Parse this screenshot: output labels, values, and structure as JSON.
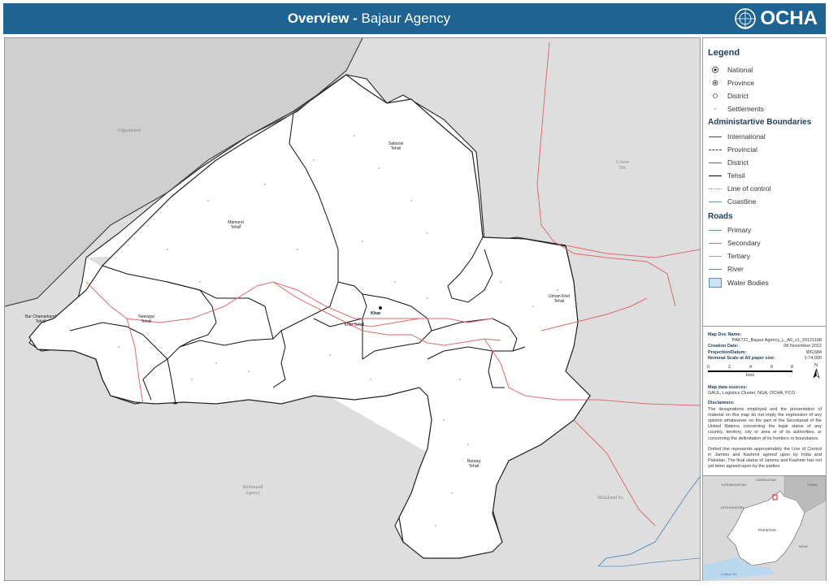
{
  "header": {
    "title_bold": "Overview - ",
    "title_rest": "Bajaur Agency",
    "logo_text": "OCHA"
  },
  "legend": {
    "title": "Legend",
    "points": [
      {
        "label": "National",
        "symbol": "star-circle"
      },
      {
        "label": "Province",
        "symbol": "dot-circle"
      },
      {
        "label": "District",
        "symbol": "circle"
      },
      {
        "label": "Settlements",
        "symbol": "small-dot"
      }
    ],
    "boundaries_title": "Administartive Boundaries",
    "boundaries": [
      {
        "label": "International",
        "color": "#444444",
        "style": "solid"
      },
      {
        "label": "Provincial",
        "color": "#444444",
        "style": "dashed"
      },
      {
        "label": "District",
        "color": "#666666",
        "style": "solid"
      },
      {
        "label": "Tehsil",
        "color": "#000000",
        "style": "solid"
      },
      {
        "label": "Line of control",
        "color": "#888888",
        "style": "dotted"
      },
      {
        "label": "Coastline",
        "color": "#5aa0a0",
        "style": "solid"
      }
    ],
    "roads_title": "Roads",
    "roads": [
      {
        "label": "Primary",
        "color": "#e05a5a"
      },
      {
        "label": "Secondary",
        "color": "#e07070"
      },
      {
        "label": "Tertiary",
        "color": "#e88888"
      },
      {
        "label": "River",
        "color": "#5b8cc4"
      }
    ],
    "water_label": "Water Bodies",
    "water_color": "#cde3f5"
  },
  "metadata": {
    "map_doc_name_label": "Map Doc Name:",
    "map_doc_name": "PAK721_Bajaur Agency_L_A0_v1_20121108",
    "creation_date_label": "Creation Date:",
    "creation_date": "08 November 2012",
    "projection_label": "Projection/Datum:",
    "projection": "WGS84",
    "scale_label": "Nominal Scale at A0 paper size:",
    "scale": "1:74,000",
    "scale_ticks": [
      "0",
      "2",
      "4",
      "6",
      "8"
    ],
    "scale_unit": "kms",
    "north": "N",
    "sources_label": "Map data sources:",
    "sources": "GAUL, Logistics Cluster, NGA, OCHA, PCO",
    "disclaimers_label": "Disclaimers:",
    "disclaimer_1": "The designations employed and the presentation of material on this map do not imply the expression of any opinion whatsoever on the part of the Secretariat of the United Nations concerning the legal status of any country, territory, city or area or of its authorities, or concerning the delimitation of its frontiers or boundaries.",
    "disclaimer_2": "Dotted line represents approximately the Line of Control in Jammu and Kashmir agreed upon by India and Pakistan. The final status of Jammu and Kashmir has not yet been agreed upon by the parties."
  },
  "map_labels": {
    "afghanistan": "Afghanistan",
    "lower_dir": "Lower Dir",
    "mohmand_agency": "Mohmand Agency",
    "malakand": "Malakand Pa",
    "salarzai": "Salarzai Tehsil",
    "mamund": "Mamund Tehsil",
    "nawagai": "Nawagai Tehsil",
    "bar_chamarkand": "Bar Chamarkand Tehsil",
    "khar": "Khar",
    "khar_tehsil": "Khar Tehsil",
    "utman_khel": "Utman Khel Tehsil",
    "barang": "Barang Tehsil"
  },
  "inset": {
    "labels": [
      "TURKMENISTAN",
      "UZBEKISTAN",
      "CHINA",
      "AFGHANISTAN",
      "PAKISTAN",
      "INDIA",
      "Arabian Sea"
    ]
  }
}
